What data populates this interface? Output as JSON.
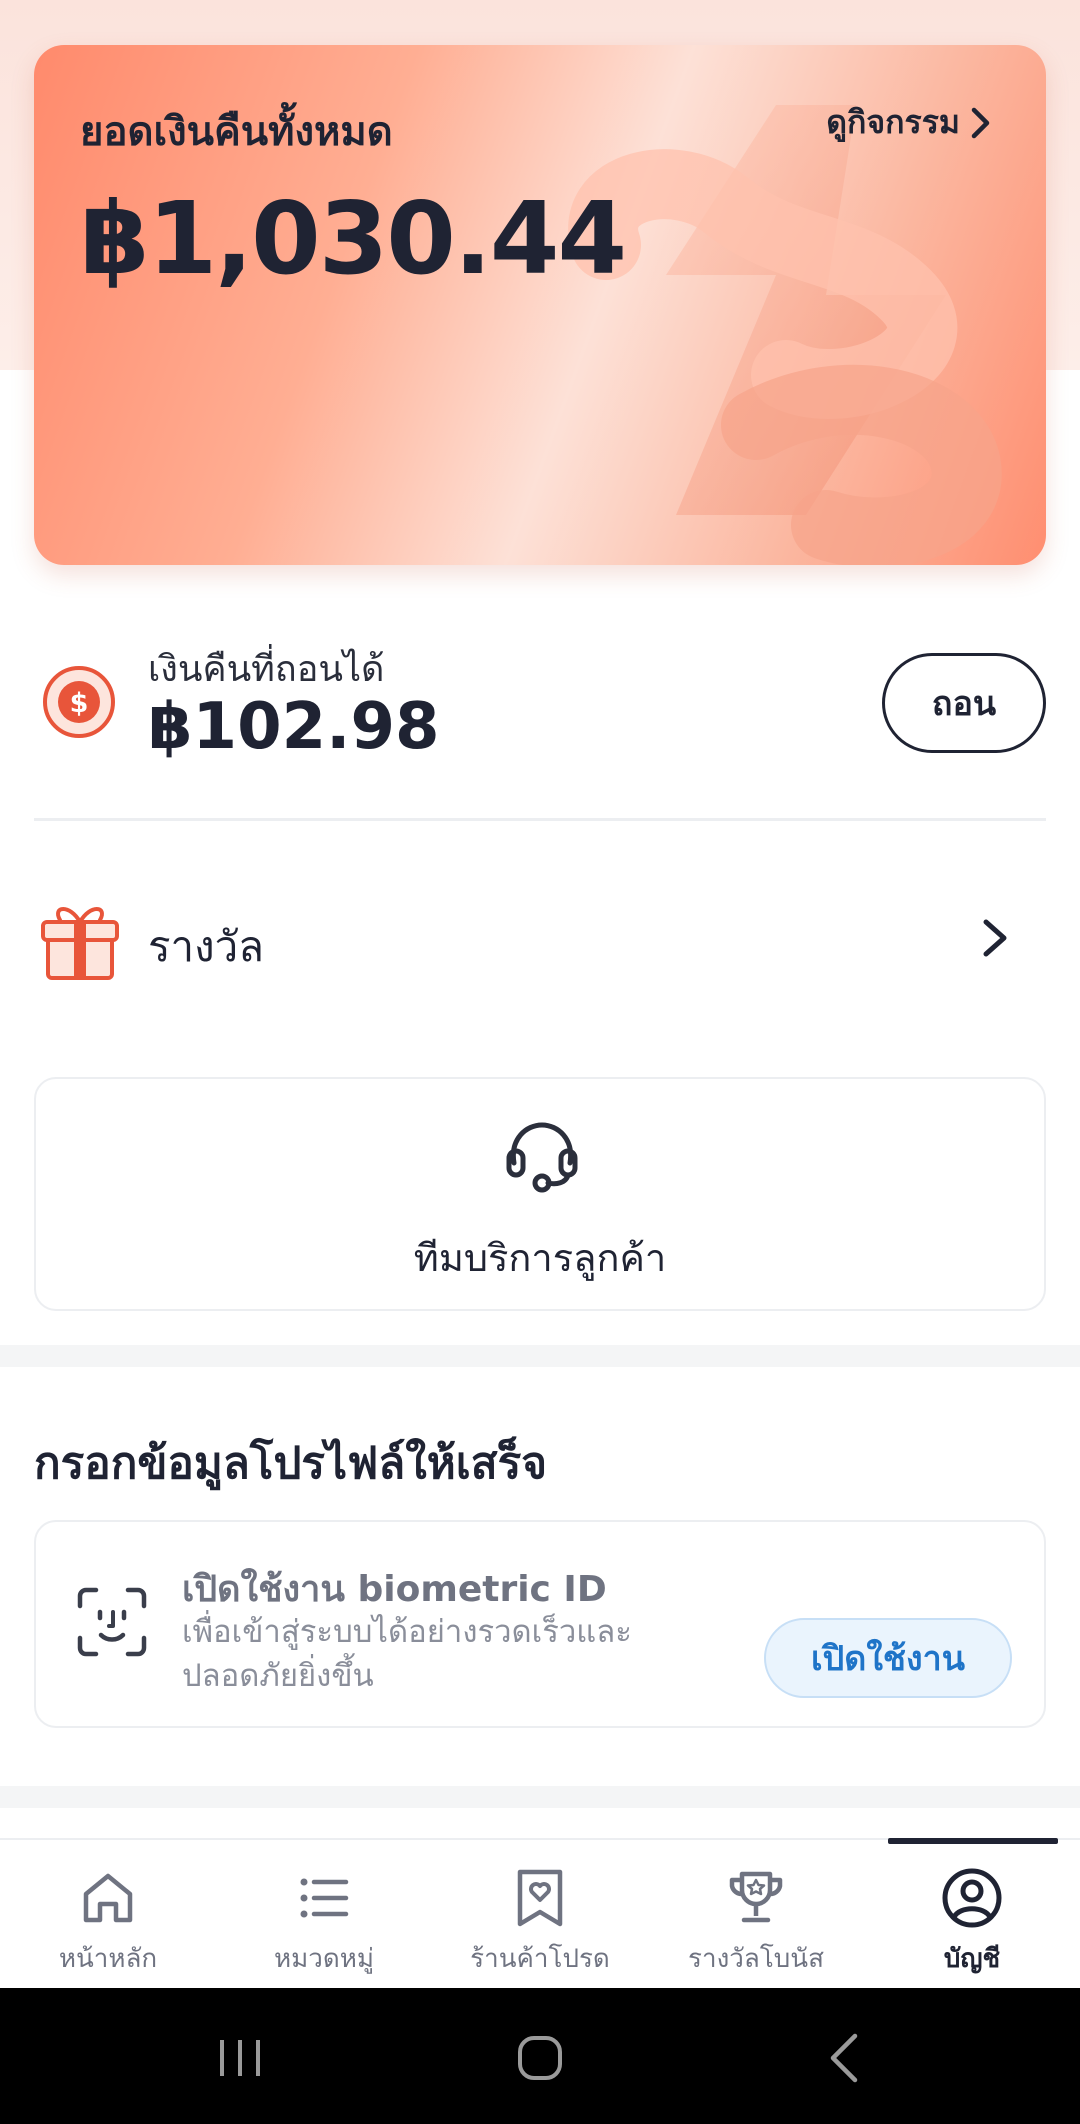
{
  "cashback": {
    "title": "ยอดเงินคืนทั้งหมด",
    "activity_link": "ดูกิจกรรม",
    "total_amount": "฿1,030.44"
  },
  "withdrawable": {
    "label": "เงินคืนที่ถอนได้",
    "amount": "฿102.98",
    "button_label": "ถอน"
  },
  "rewards": {
    "label": "รางวัล"
  },
  "support": {
    "label": "ทีมบริการลูกค้า"
  },
  "profile": {
    "section_title": "กรอกข้อมูลโปรไฟล์ให้เสร็จ",
    "biometric_title": "เปิดใช้งาน biometric ID",
    "biometric_desc": "เพื่อเข้าสู่ระบบได้อย่างรวดเร็วและปลอดภัยยิ่งขึ้น",
    "biometric_button": "เปิดใช้งาน"
  },
  "nav": {
    "items": [
      {
        "label": "หน้าหลัก",
        "icon": "home-icon",
        "active": false
      },
      {
        "label": "หมวดหมู่",
        "icon": "list-icon",
        "active": false
      },
      {
        "label": "ร้านค้าโปรด",
        "icon": "favorite-store-icon",
        "active": false
      },
      {
        "label": "รางวัลโบนัส",
        "icon": "trophy-icon",
        "active": false
      },
      {
        "label": "บัญชี",
        "icon": "account-icon",
        "active": true
      }
    ]
  },
  "colors": {
    "accent": "#e8553a",
    "text_dark": "#1f2333",
    "link_blue": "#1f74c8"
  }
}
